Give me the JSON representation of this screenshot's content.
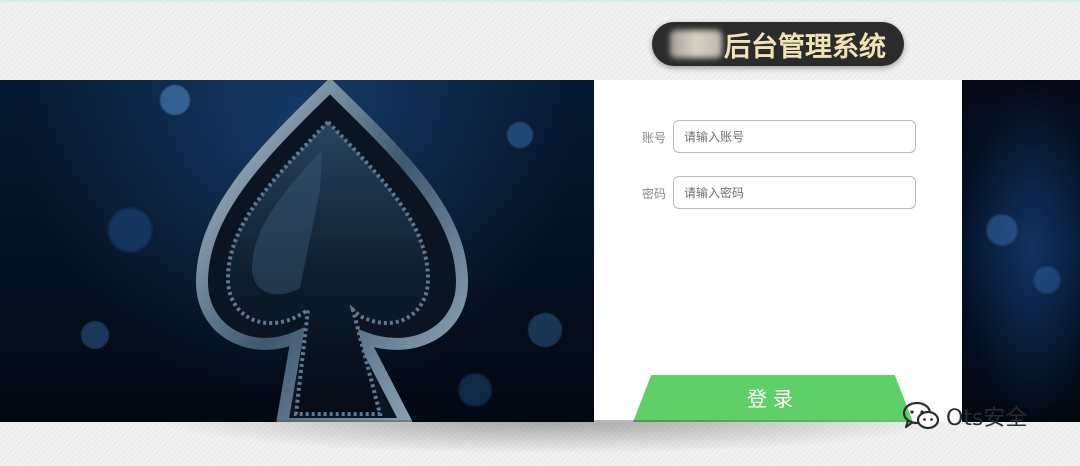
{
  "header": {
    "title": "后台管理系统"
  },
  "login": {
    "account_label": "账号",
    "account_placeholder": "请输入账号",
    "password_label": "密码",
    "password_placeholder": "请输入密码",
    "submit_label": "登录"
  },
  "watermark": {
    "text": "Ots安全"
  },
  "colors": {
    "accent": "#5fcf67",
    "title_bg": "#2b2b2b",
    "title_text": "#f3e2b4",
    "hero_bg": "#04101f"
  },
  "icons": {
    "hero": "spade-icon",
    "watermark": "wechat-icon"
  }
}
